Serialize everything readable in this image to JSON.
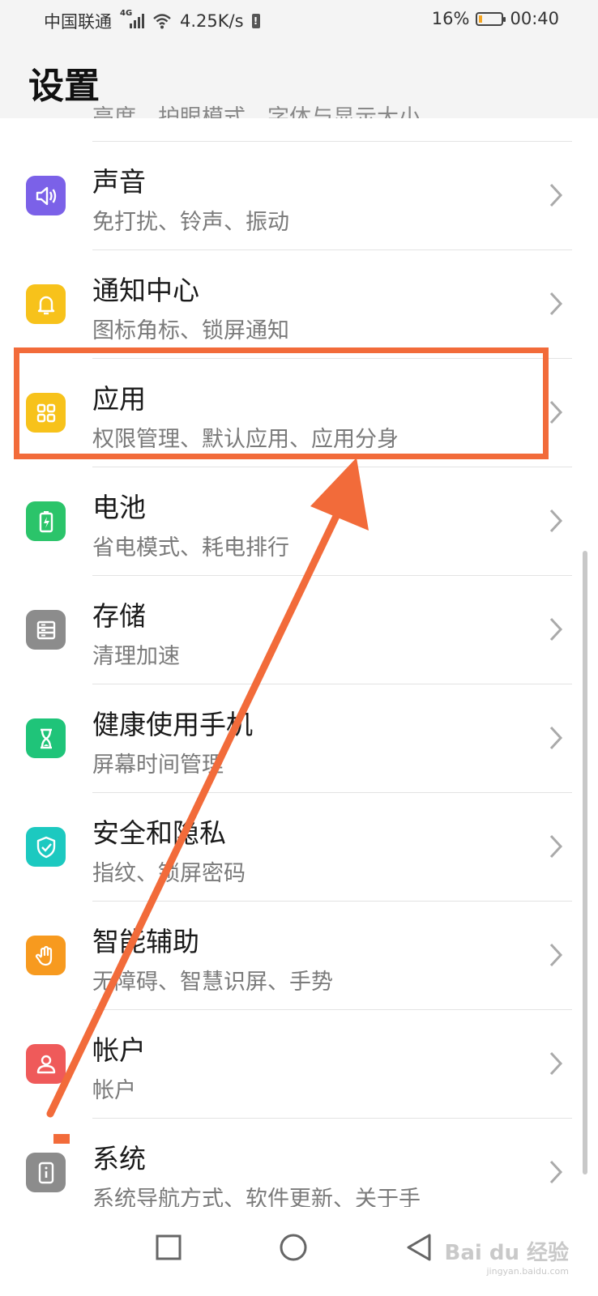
{
  "status_bar": {
    "carrier": "中国联通",
    "network_type": "4G",
    "speed": "4.25K/s",
    "battery_percent": "16%",
    "battery_level": 0.16,
    "time": "00:40"
  },
  "header": {
    "title": "设置",
    "partial_previous_subtitle": "亮度、护眼模式、字体与显示大小"
  },
  "settings": [
    {
      "title": "声音",
      "subtitle": "免打扰、铃声、振动",
      "icon": "speaker-icon",
      "color": "#7b61e8"
    },
    {
      "title": "通知中心",
      "subtitle": "图标角标、锁屏通知",
      "icon": "bell-icon",
      "color": "#f7c21b"
    },
    {
      "title": "应用",
      "subtitle": "权限管理、默认应用、应用分身",
      "icon": "apps-grid-icon",
      "color": "#f7c21b"
    },
    {
      "title": "电池",
      "subtitle": "省电模式、耗电排行",
      "icon": "battery-icon",
      "color": "#2bc46a"
    },
    {
      "title": "存储",
      "subtitle": "清理加速",
      "icon": "storage-icon",
      "color": "#8c8c8c"
    },
    {
      "title": "健康使用手机",
      "subtitle": "屏幕时间管理",
      "icon": "hourglass-icon",
      "color": "#1fc479"
    },
    {
      "title": "安全和隐私",
      "subtitle": "指纹、锁屏密码",
      "icon": "shield-icon",
      "color": "#1cc9c0"
    },
    {
      "title": "智能辅助",
      "subtitle": "无障碍、智慧识屏、手势",
      "icon": "hand-icon",
      "color": "#f79a1f"
    },
    {
      "title": "帐户",
      "subtitle": "帐户",
      "icon": "account-icon",
      "color": "#ef5a5a"
    },
    {
      "title": "系统",
      "subtitle": "系统导航方式、软件更新、关于手",
      "icon": "phone-info-icon",
      "color": "#8c8c8c"
    }
  ],
  "annotation": {
    "highlight_color": "#f26b3a"
  },
  "nav_bar": {
    "recent": "square-icon",
    "home": "circle-icon",
    "back": "triangle-back-icon"
  },
  "watermark": {
    "text": "Bai du 经验",
    "url": "jingyan.baidu.com"
  }
}
